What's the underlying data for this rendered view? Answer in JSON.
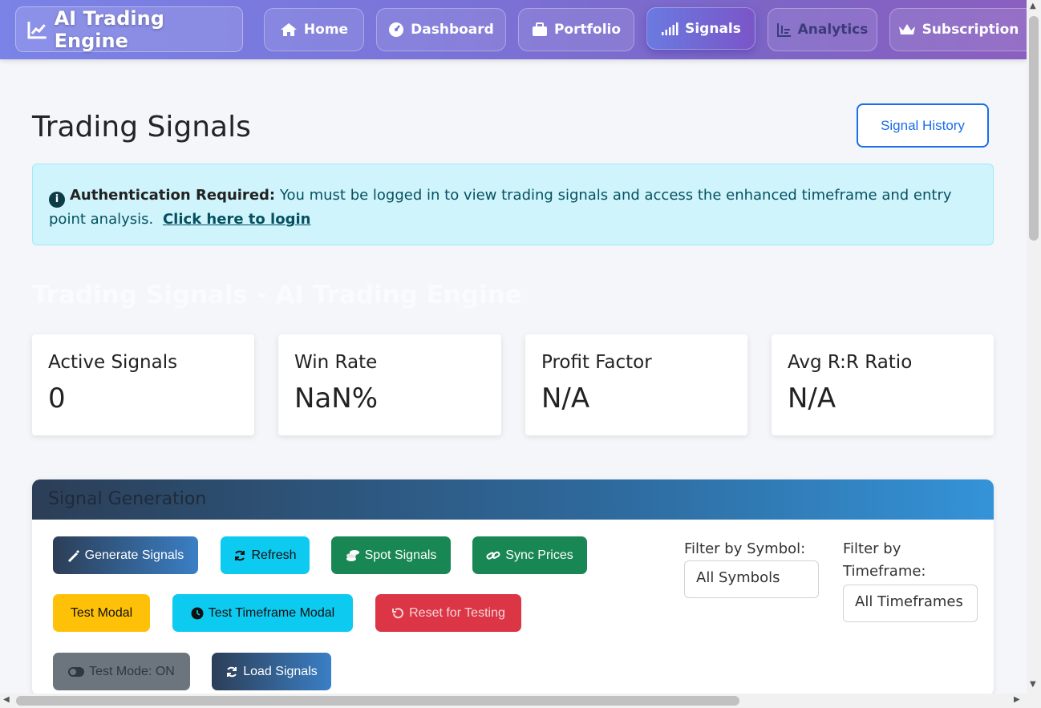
{
  "nav": {
    "brand": "AI Trading Engine",
    "items": [
      {
        "label": "Home",
        "icon": "home-icon"
      },
      {
        "label": "Dashboard",
        "icon": "dashboard-icon"
      },
      {
        "label": "Portfolio",
        "icon": "briefcase-icon"
      },
      {
        "label": "Signals",
        "icon": "signal-bars-icon"
      },
      {
        "label": "Analytics",
        "icon": "chart-bar-icon"
      },
      {
        "label": "Subscription",
        "icon": "crown-icon"
      }
    ]
  },
  "page": {
    "title": "Trading Signals",
    "history_button": "Signal History",
    "ghost_title": "Trading Signals - AI Trading Engine"
  },
  "alert": {
    "strong": "Authentication Required:",
    "text": "You must be logged in to view trading signals and access the enhanced timeframe and entry point analysis.",
    "link": "Click here to login"
  },
  "stats": [
    {
      "label": "Active Signals",
      "value": "0"
    },
    {
      "label": "Win Rate",
      "value": "NaN%"
    },
    {
      "label": "Profit Factor",
      "value": "N/A"
    },
    {
      "label": "Avg R:R Ratio",
      "value": "N/A"
    }
  ],
  "panel": {
    "title": "Signal Generation",
    "buttons": {
      "generate": "Generate Signals",
      "refresh": "Refresh",
      "spot": "Spot Signals",
      "sync": "Sync Prices",
      "test_modal": "Test Modal",
      "test_timeframe": "Test Timeframe Modal",
      "reset": "Reset for Testing",
      "test_mode": "Test Mode: ON",
      "load": "Load Signals"
    },
    "filters": {
      "symbol_label": "Filter by Symbol:",
      "symbol_value": "All Symbols",
      "timeframe_label": "Filter by Timeframe:",
      "timeframe_value": "All Timeframes"
    }
  }
}
